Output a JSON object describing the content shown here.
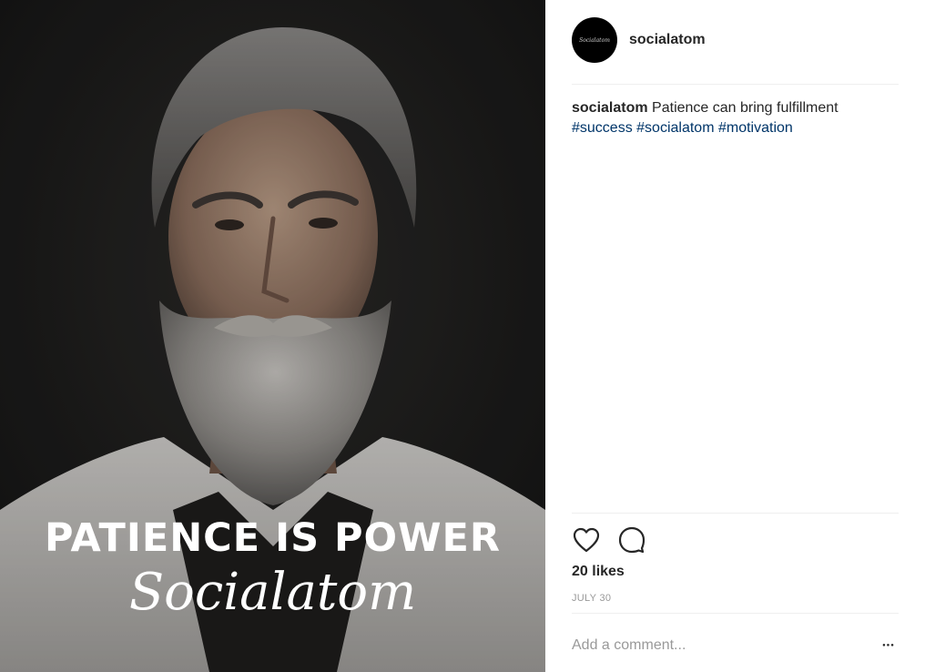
{
  "post": {
    "image": {
      "headline": "PATIENCE IS POWER",
      "script_text": "Socialatom"
    },
    "header": {
      "avatar_text": "Socialatom",
      "username": "socialatom"
    },
    "caption": {
      "username": "socialatom",
      "text": "Patience can bring fulfillment",
      "hashtags": [
        "#success",
        "#socialatom",
        "#motivation"
      ]
    },
    "actions": {
      "like_icon": "heart-icon",
      "comment_icon": "comment-bubble-icon"
    },
    "likes": "20 likes",
    "date": "JULY 30",
    "comment": {
      "placeholder": "Add a comment...",
      "more_icon": "more-options-icon"
    },
    "colors": {
      "hashtag": "#003569",
      "text": "#262626",
      "muted": "#999999",
      "divider": "#efefef"
    }
  }
}
